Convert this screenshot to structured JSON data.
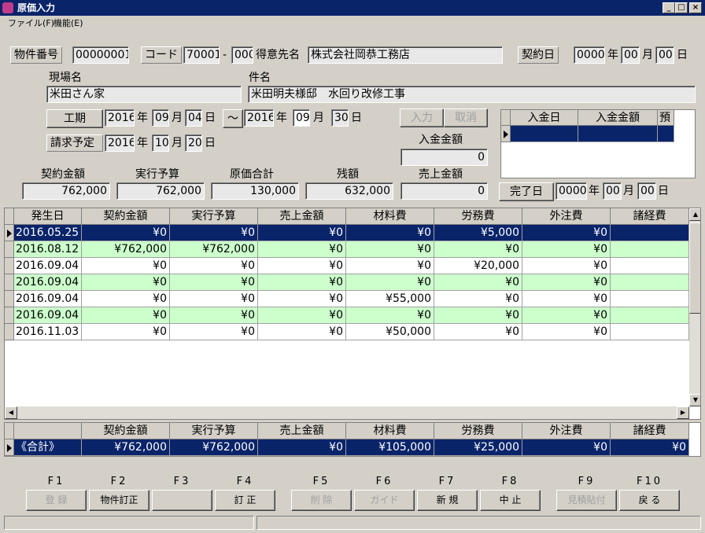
{
  "window": {
    "title": "原価入力"
  },
  "menu": [
    "ファイル(F)",
    "機能(E)"
  ],
  "header": {
    "bukken_label": "物件番号",
    "bukken_value": "00000001",
    "code_label": "コード",
    "code_value": "70001",
    "code_dash": "-",
    "code_sub": "000",
    "tokui_label": "得意先名",
    "tokui_value": "株式会社岡恭工務店",
    "keiyaku_date_label": "契約日",
    "keiyaku_year": "0000",
    "keiyaku_month": "00",
    "keiyaku_day": "00",
    "nen": "年",
    "tsuki": "月",
    "hi": "日",
    "genba_label": "現場名",
    "genba_value": "米田さん家",
    "kenmei_label": "件名",
    "kenmei_value": "米田明夫様邸　水回り改修工事",
    "kouki_label": "工期",
    "kouki_from_year": "2016",
    "kouki_from_month": "09",
    "kouki_from_day": "04",
    "tilde": "～",
    "kouki_to_year": "2016",
    "kouki_to_month": "09",
    "kouki_to_day": "30",
    "seikyu_label": "請求予定",
    "seikyu_year": "2016",
    "seikyu_month": "10",
    "seikyu_day": "20",
    "input_btn": "入力",
    "cancel_btn": "取消",
    "nyukin_amount_label": "入金金額",
    "nyukin_amount_value": "0",
    "kanryo_label": "完了日",
    "kanryo_year": "0000",
    "kanryo_month": "00",
    "kanryo_day": "00"
  },
  "deposit_grid": {
    "columns": [
      "入金日",
      "入金金額",
      "預"
    ]
  },
  "summary": {
    "labels": [
      "契約金額",
      "実行予算",
      "原価合計",
      "残額",
      "売上金額"
    ],
    "values": [
      "762,000",
      "762,000",
      "130,000",
      "632,000",
      "0"
    ]
  },
  "main_grid": {
    "columns": [
      "発生日",
      "契約金額",
      "実行予算",
      "売上金額",
      "材料費",
      "労務費",
      "外注費",
      "諸経費"
    ],
    "rows": [
      [
        "2016.05.25",
        "¥0",
        "¥0",
        "¥0",
        "¥0",
        "¥5,000",
        "¥0",
        ""
      ],
      [
        "2016.08.12",
        "¥762,000",
        "¥762,000",
        "¥0",
        "¥0",
        "¥0",
        "¥0",
        ""
      ],
      [
        "2016.09.04",
        "¥0",
        "¥0",
        "¥0",
        "¥0",
        "¥20,000",
        "¥0",
        ""
      ],
      [
        "2016.09.04",
        "¥0",
        "¥0",
        "¥0",
        "¥0",
        "¥0",
        "¥0",
        ""
      ],
      [
        "2016.09.04",
        "¥0",
        "¥0",
        "¥0",
        "¥55,000",
        "¥0",
        "¥0",
        ""
      ],
      [
        "2016.09.04",
        "¥0",
        "¥0",
        "¥0",
        "¥0",
        "¥0",
        "¥0",
        ""
      ],
      [
        "2016.11.03",
        "¥0",
        "¥0",
        "¥0",
        "¥50,000",
        "¥0",
        "¥0",
        ""
      ]
    ]
  },
  "total_grid": {
    "columns": [
      "",
      "契約金額",
      "実行予算",
      "売上金額",
      "材料費",
      "労務費",
      "外注費",
      "諸経費"
    ],
    "row": [
      "《合計》",
      "¥762,000",
      "¥762,000",
      "¥0",
      "¥105,000",
      "¥25,000",
      "¥0",
      "¥0"
    ]
  },
  "fkeys": [
    {
      "key": "F1",
      "label": "登 録",
      "enabled": false
    },
    {
      "key": "F2",
      "label": "物件訂正",
      "enabled": true
    },
    {
      "key": "F3",
      "label": "",
      "enabled": true
    },
    {
      "key": "F4",
      "label": "訂 正",
      "enabled": true
    },
    {
      "key": "F5",
      "label": "削 除",
      "enabled": false
    },
    {
      "key": "F6",
      "label": "ガイド",
      "enabled": false
    },
    {
      "key": "F7",
      "label": "新 規",
      "enabled": true
    },
    {
      "key": "F8",
      "label": "中 止",
      "enabled": true
    },
    {
      "key": "F9",
      "label": "見積貼付",
      "enabled": false
    },
    {
      "key": "F10",
      "label": "戻 る",
      "enabled": true
    }
  ],
  "colors": {
    "titlebar": "#0a246a",
    "selected_row": "#0a246a",
    "alt_row": "#ccffcc",
    "face": "#d4d0c8"
  }
}
